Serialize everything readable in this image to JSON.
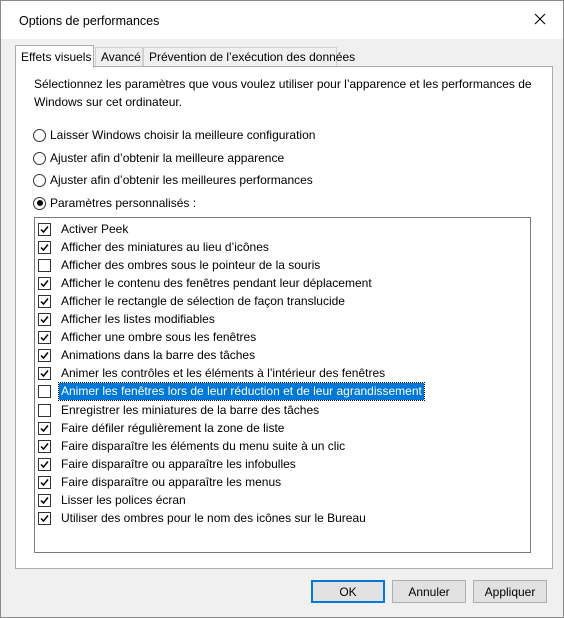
{
  "window": {
    "title": "Options de performances"
  },
  "tabs": [
    {
      "label": "Effets visuels",
      "active": true
    },
    {
      "label": "Avancé",
      "active": false
    },
    {
      "label": "Prévention de l’exécution des données",
      "active": false
    }
  ],
  "description": "Sélectionnez les paramètres que vous voulez utiliser pour l’apparence et les performances de Windows sur cet ordinateur.",
  "radios": [
    {
      "label": "Laisser Windows choisir la meilleure configuration",
      "checked": false
    },
    {
      "label": "Ajuster afin d’obtenir la meilleure apparence",
      "checked": false
    },
    {
      "label": "Ajuster afin d’obtenir les meilleures performances",
      "checked": false
    },
    {
      "label": "Paramètres personnalisés :",
      "checked": true
    }
  ],
  "effects": [
    {
      "label": "Activer Peek",
      "checked": true
    },
    {
      "label": "Afficher des miniatures au lieu d’icônes",
      "checked": true
    },
    {
      "label": "Afficher des ombres sous le pointeur de la souris",
      "checked": false
    },
    {
      "label": "Afficher le contenu des fenêtres pendant leur déplacement",
      "checked": true
    },
    {
      "label": "Afficher le rectangle de sélection de façon translucide",
      "checked": true
    },
    {
      "label": "Afficher les listes modifiables",
      "checked": true
    },
    {
      "label": "Afficher une ombre sous les fenêtres",
      "checked": true
    },
    {
      "label": "Animations dans la barre des tâches",
      "checked": true
    },
    {
      "label": "Animer les contrôles et les éléments à l’intérieur des fenêtres",
      "checked": true
    },
    {
      "label": "Animer les fenêtres lors de leur réduction et de leur agrandissement",
      "checked": false,
      "selected": true
    },
    {
      "label": "Enregistrer les miniatures de la barre des tâches",
      "checked": false
    },
    {
      "label": "Faire défiler régulièrement la zone de liste",
      "checked": true
    },
    {
      "label": "Faire disparaître les éléments du menu suite à un clic",
      "checked": true
    },
    {
      "label": "Faire disparaître ou apparaître les infobulles",
      "checked": true
    },
    {
      "label": "Faire disparaître ou apparaître les menus",
      "checked": true
    },
    {
      "label": "Lisser les polices écran",
      "checked": true
    },
    {
      "label": "Utiliser des ombres pour le nom des icônes sur le Bureau",
      "checked": true
    }
  ],
  "buttons": {
    "ok": "OK",
    "cancel": "Annuler",
    "apply": "Appliquer"
  },
  "icons": {
    "close": "close-icon",
    "checkbox_mark": "checkmark-icon"
  },
  "colors": {
    "selection": "#0078d7",
    "default_button_border": "#0078d7"
  }
}
